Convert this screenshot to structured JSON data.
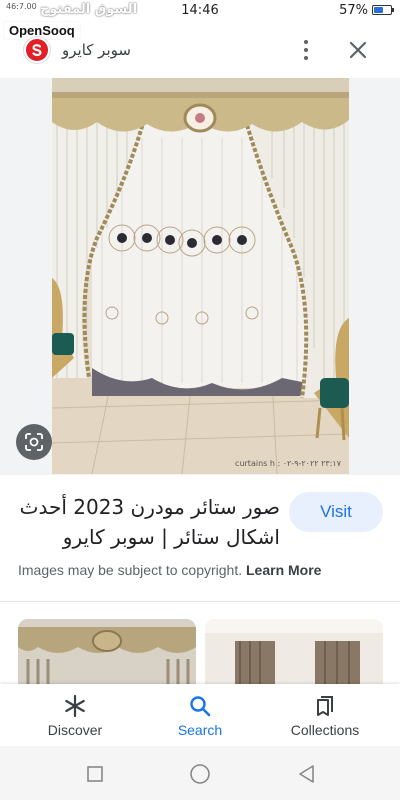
{
  "status_bar": {
    "left_speed": "46:7.00",
    "watermark": "السوق المفتوح",
    "time": "14:46",
    "battery": "57%",
    "battery_level": 0.57
  },
  "brand_tag": "OpenSooq",
  "header": {
    "site_name": "سوبر كايرو",
    "site_logo_icon": "site-logo-icon",
    "more_icon": "more-vert-icon",
    "close_icon": "close-icon"
  },
  "image": {
    "caption": "curtains h : ٢٣:١٧ ٢٠٢٢-٩-٠٢",
    "lens_icon": "lens-icon"
  },
  "result": {
    "title": "صور ستائر مودرن 2023 أحدث اشكال ستائر | سوبر كايرو",
    "visit_label": "Visit",
    "copyright_text": "Images may be subject to copyright.",
    "learn_more_label": "Learn More"
  },
  "bottom_nav": {
    "items": [
      {
        "label": "Discover",
        "icon": "asterisk-icon"
      },
      {
        "label": "Search",
        "icon": "search-icon"
      },
      {
        "label": "Collections",
        "icon": "collections-icon"
      }
    ],
    "active_color": "#1a73e8"
  },
  "system_nav": {
    "buttons": [
      "recents-icon",
      "home-icon",
      "back-icon"
    ]
  },
  "colors": {
    "accent": "#1a73e8",
    "visit_bg": "#e8f0fe",
    "brand_red": "#e21f26"
  }
}
